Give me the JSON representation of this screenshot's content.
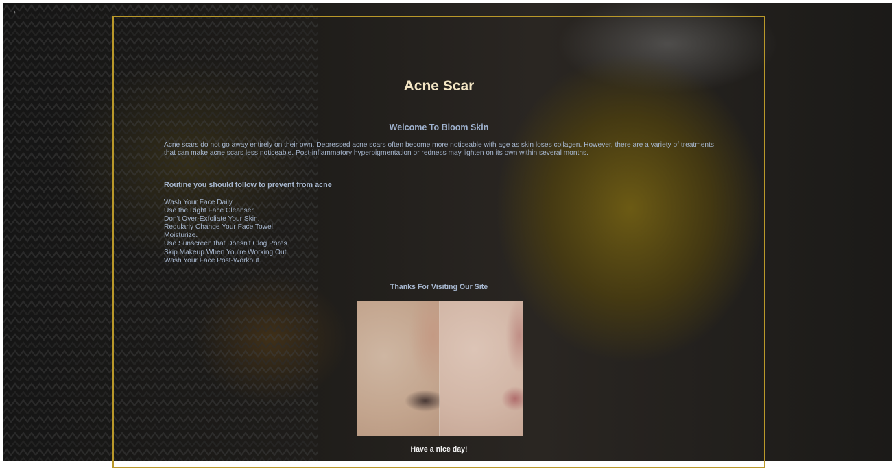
{
  "page": {
    "title": "Acne Scar",
    "welcome": "Welcome To Bloom Skin",
    "intro": "Acne scars do not go away entirely on their own. Depressed acne scars often become more noticeable with age as skin loses collagen. However, there are a variety of treatments that can make acne scars less noticeable. Post-inflammatory hyperpigmentation or redness may lighten on its own within several months.",
    "routine_heading": "Routine you should follow to prevent from acne",
    "tips": [
      "Wash Your Face Daily.",
      "Use the Right Face Cleanser.",
      "Don't Over-Exfoliate Your Skin.",
      "Regularly Change Your Face Towel.",
      "Moisturize.",
      "Use Sunscreen that Doesn't Clog Pores.",
      "Skip Makeup When You're Working Out.",
      "Wash Your Face Post-Workout."
    ],
    "thanks": "Thanks For Visiting Our Site",
    "goodbye": "Have a nice day!"
  },
  "colors": {
    "frame_border": "#b9982a",
    "title": "#f4e6c4",
    "body_text": "#a7b7cf"
  },
  "icons": {
    "corner_mark": "chevron-right-icon"
  }
}
